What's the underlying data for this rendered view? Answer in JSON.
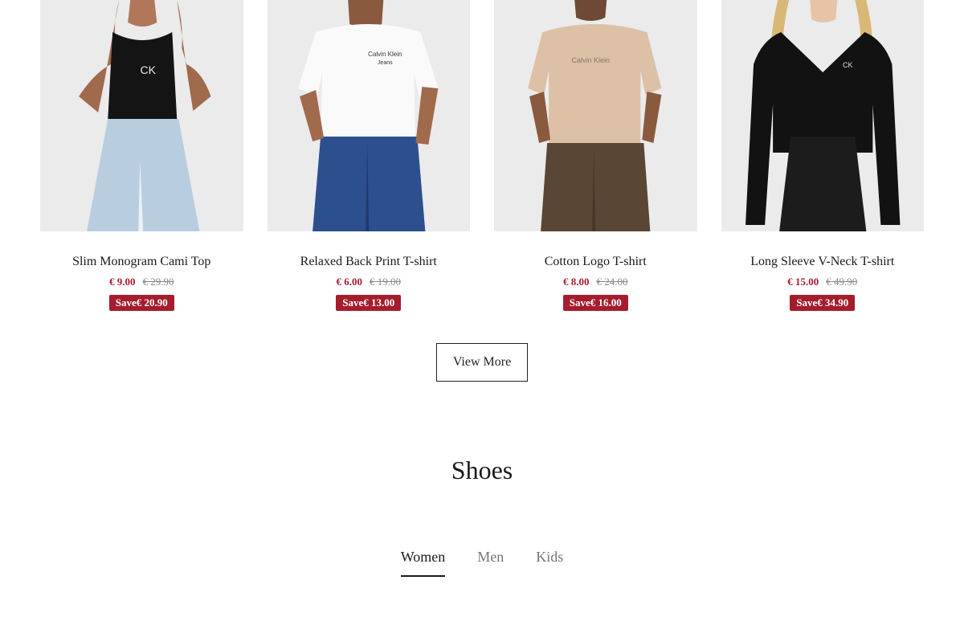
{
  "products": [
    {
      "name": "Slim Monogram Cami Top",
      "price": "€ 9.00",
      "original_price": "€ 29.90",
      "save": "Save€ 20.90"
    },
    {
      "name": "Relaxed Back Print T-shirt",
      "price": "€ 6.00",
      "original_price": "€ 19.00",
      "save": "Save€ 13.00"
    },
    {
      "name": "Cotton Logo T-shirt",
      "price": "€ 8.00",
      "original_price": "€ 24.00",
      "save": "Save€ 16.00"
    },
    {
      "name": "Long Sleeve V-Neck T-shirt",
      "price": "€ 15.00",
      "original_price": "€ 49.90",
      "save": "Save€ 34.90"
    }
  ],
  "view_more_label": "View More",
  "section": {
    "title": "Shoes",
    "tabs": [
      {
        "label": "Women",
        "active": true
      },
      {
        "label": "Men",
        "active": false
      },
      {
        "label": "Kids",
        "active": false
      }
    ]
  },
  "colors": {
    "sale_red": "#a51d2d",
    "text": "#1a1a1a",
    "muted": "#767676",
    "photo_bg": "#ececec"
  }
}
